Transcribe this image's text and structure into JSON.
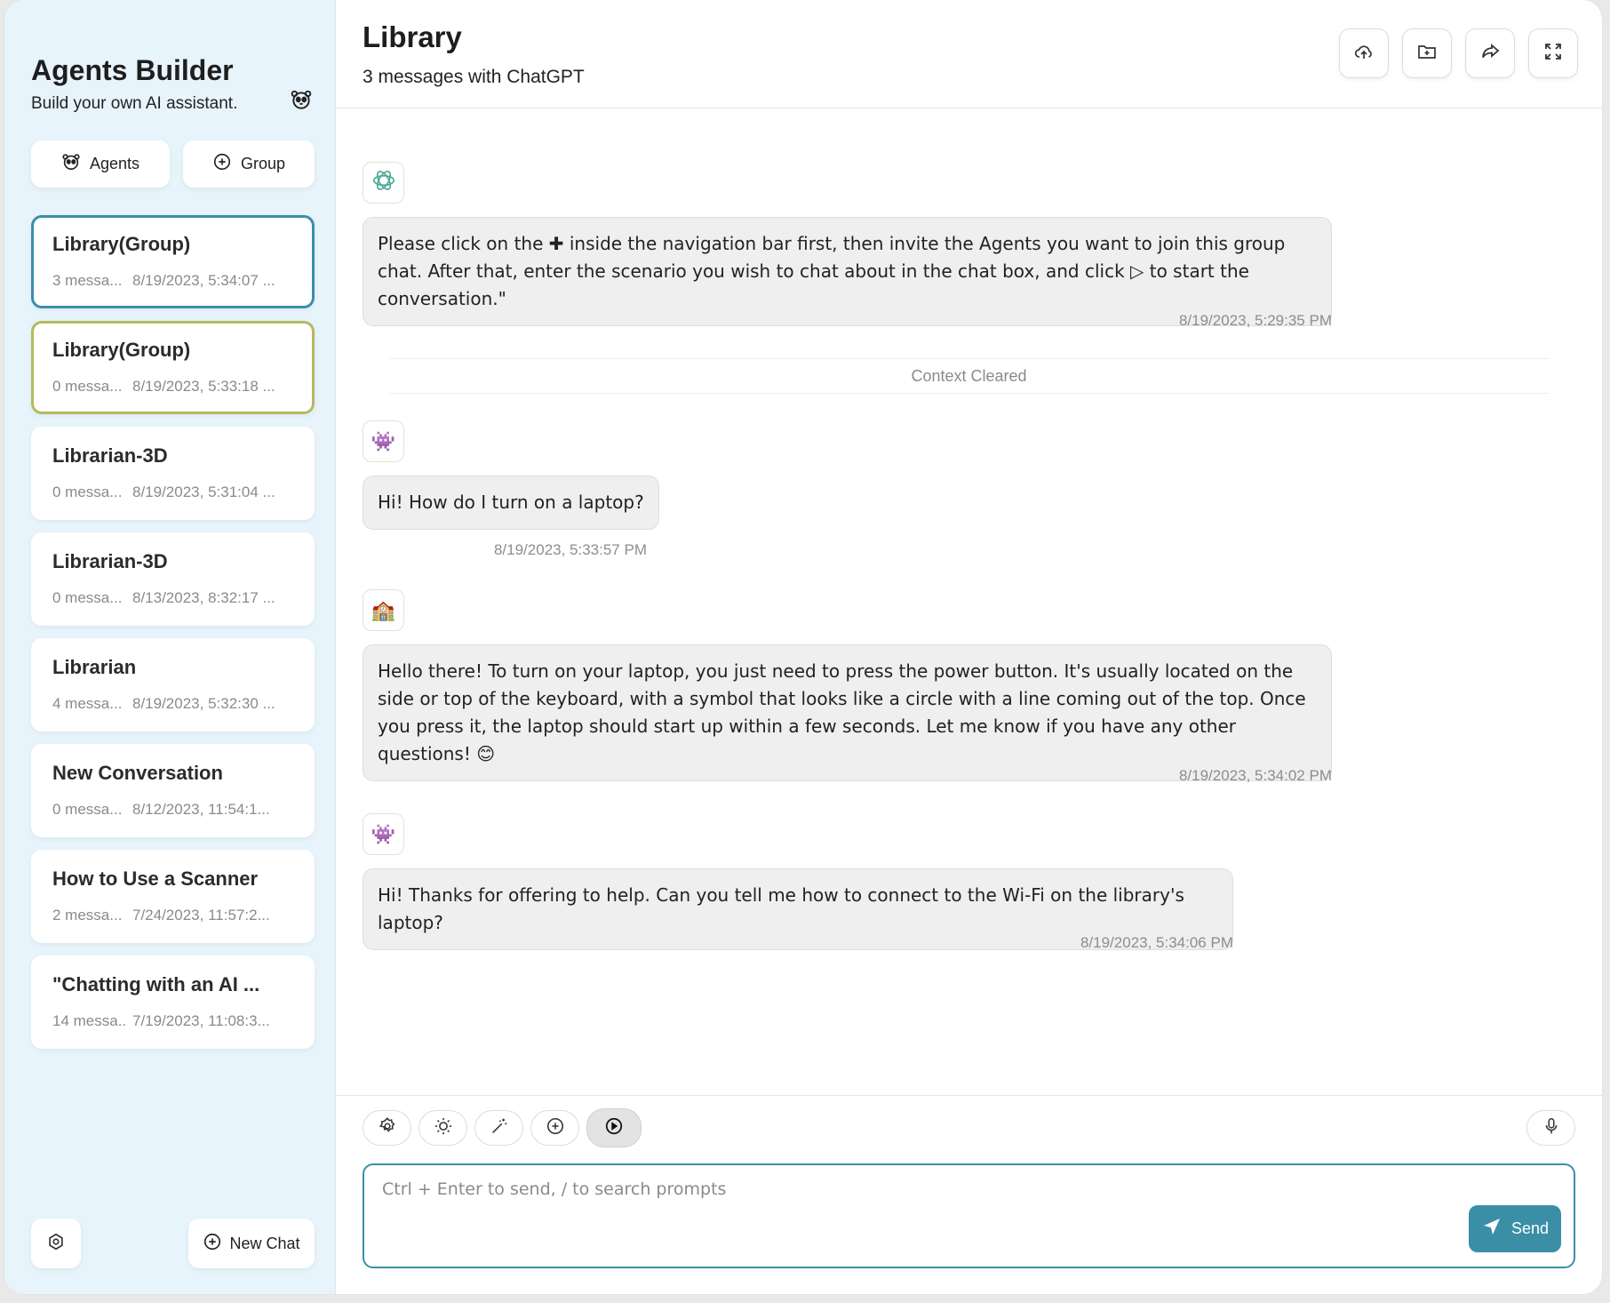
{
  "sidebar": {
    "title": "Agents Builder",
    "subtitle": "Build your own AI assistant.",
    "agents_label": "Agents",
    "group_label": "Group",
    "new_chat_label": "New Chat",
    "chats": [
      {
        "title": "Library(Group)",
        "count": "3 messa...",
        "date": "8/19/2023, 5:34:07 ..."
      },
      {
        "title": "Library(Group)",
        "count": "0 messa...",
        "date": "8/19/2023, 5:33:18 ..."
      },
      {
        "title": "Librarian-3D",
        "count": "0 messa...",
        "date": "8/19/2023, 5:31:04 ..."
      },
      {
        "title": "Librarian-3D",
        "count": "0 messa...",
        "date": "8/13/2023, 8:32:17 ..."
      },
      {
        "title": "Librarian",
        "count": "4 messa...",
        "date": "8/19/2023, 5:32:30 ..."
      },
      {
        "title": "New Conversation",
        "count": "0 messa...",
        "date": "8/12/2023, 11:54:1..."
      },
      {
        "title": "How to Use a Scanner",
        "count": "2 messa...",
        "date": "7/24/2023, 11:57:2..."
      },
      {
        "title": "\"Chatting with an AI ...",
        "count": "14 messa...",
        "date": "7/19/2023, 11:08:3..."
      }
    ]
  },
  "header": {
    "title": "Library",
    "subtitle": "3 messages with ChatGPT"
  },
  "messages": {
    "m1_text": "Please click on the ✚ inside the navigation bar first, then invite the Agents you want to join this group chat. After that, enter the scenario you wish to chat about in the chat box, and click ▷ to start the conversation.\"",
    "m1_time": "8/19/2023, 5:29:35 PM",
    "divider": "Context Cleared",
    "m2_avatar": "👾",
    "m2_text": "Hi! How do I turn on a laptop?",
    "m2_time": "8/19/2023, 5:33:57 PM",
    "m3_avatar": "🏫",
    "m3_text": "Hello there! To turn on your laptop, you just need to press the power button. It's usually located on the side or top of the keyboard, with a symbol that looks like a circle with a line coming out of the top. Once you press it, the laptop should start up within a few seconds. Let me know if you have any other questions! 😊",
    "m3_time": "8/19/2023, 5:34:02 PM",
    "m4_avatar": "👾",
    "m4_text": "Hi! Thanks for offering to help. Can you tell me how to connect to the Wi-Fi on the library's laptop?",
    "m4_time": "8/19/2023, 5:34:06 PM"
  },
  "composer": {
    "placeholder": "Ctrl + Enter to send, / to search prompts",
    "send_label": "Send"
  },
  "colors": {
    "accent": "#3a8fa7",
    "sidebar_bg": "#e7f4fb",
    "selected_alt": "#b6b95e"
  }
}
